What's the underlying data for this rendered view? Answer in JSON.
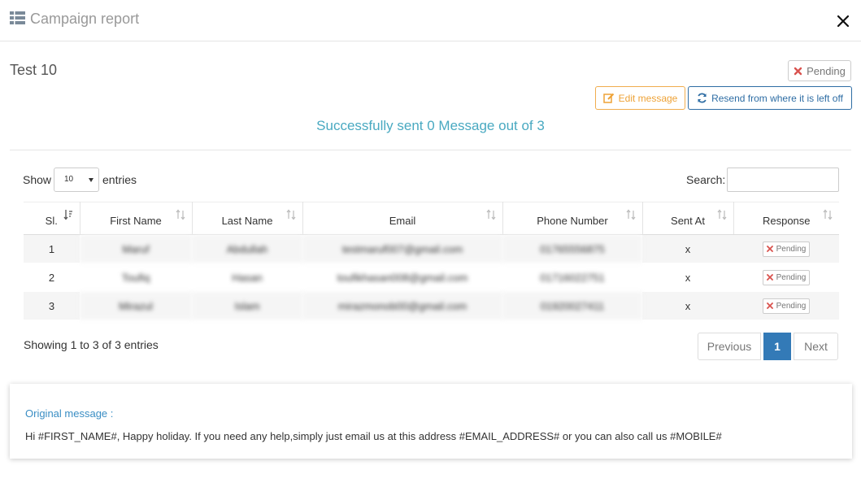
{
  "header": {
    "title": "Campaign report",
    "icon": "list-icon",
    "close_icon": "close-icon"
  },
  "campaign": {
    "name": "Test 10",
    "status_label": "Pending"
  },
  "actions": {
    "edit_label": "Edit message",
    "resend_label": "Resend from where it is left off"
  },
  "summary": "Successfully sent 0 Message out of 3",
  "table_controls": {
    "show_label": "Show",
    "entries_value": "10",
    "entries_label": "entries",
    "search_label": "Search:"
  },
  "table": {
    "columns": [
      "Sl.",
      "First Name",
      "Last Name",
      "Email",
      "Phone Number",
      "Sent At",
      "Response"
    ],
    "rows": [
      {
        "sl": "1",
        "first_name": "Maruf",
        "last_name": "Abdullah",
        "email": "testmaruf007@gmail.com",
        "phone": "01765556875",
        "sent_at": "x",
        "response": "Pending"
      },
      {
        "sl": "2",
        "first_name": "Toufiq",
        "last_name": "Hasan",
        "email": "toufikhasan008@gmail.com",
        "phone": "01716022751",
        "sent_at": "x",
        "response": "Pending"
      },
      {
        "sl": "3",
        "first_name": "Mirazul",
        "last_name": "Islam",
        "email": "mirazmonob00@gmail.com",
        "phone": "01920027411",
        "sent_at": "x",
        "response": "Pending"
      }
    ]
  },
  "pagination": {
    "info": "Showing 1 to 3 of 3 entries",
    "previous": "Previous",
    "current": "1",
    "next": "Next"
  },
  "original_message": {
    "title": "Original message :",
    "body": "Hi #FIRST_NAME#, Happy holiday. If you need any help,simply just email us at this address #EMAIL_ADDRESS# or you can also call us #MOBILE#"
  },
  "colors": {
    "primary": "#337ab7",
    "warning": "#f0ad4e",
    "info_text": "#49a9c1",
    "danger": "#d9534f"
  }
}
